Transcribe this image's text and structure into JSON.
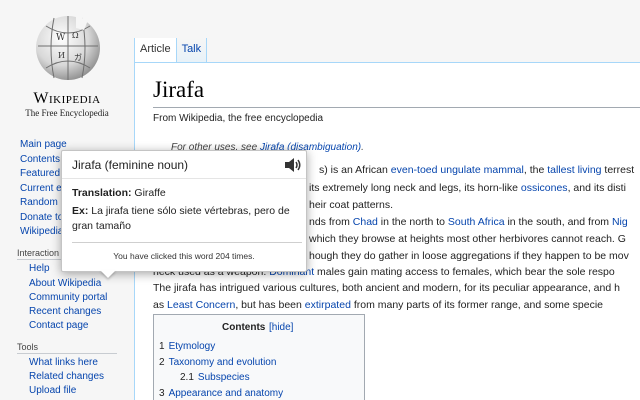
{
  "logo": {
    "wordmark": "Wikipedia",
    "tagline": "The Free Encyclopedia"
  },
  "sidebar": {
    "main_links": [
      "Main page",
      "Contents",
      "Featured c",
      "Current ev",
      "Random a",
      "Donate to",
      "Wikipedia"
    ],
    "interaction_heading": "Interaction",
    "interaction_links": [
      "Help",
      "About Wikipedia",
      "Community portal",
      "Recent changes",
      "Contact page"
    ],
    "tools_heading": "Tools",
    "tools_links": [
      "What links here",
      "Related changes",
      "Upload file"
    ]
  },
  "tabs": {
    "article": "Article",
    "talk": "Talk"
  },
  "article": {
    "title": "Jirafa",
    "subtitle": "From Wikipedia, the free encyclopedia",
    "hatnote_prefix": "For other uses, see ",
    "hatnote_link": "Jirafa (disambiguation)",
    "hatnote_suffix": ".",
    "line1": {
      "a": "s) is an African ",
      "b": "even-toed ungulate mammal",
      "c": ", the ",
      "d": "tallest living",
      "e": " terrest"
    },
    "line2": {
      "a": "its extremely long neck and legs, its horn-like ",
      "b": "ossicones",
      "c": ", and its disti"
    },
    "line3": {
      "a": "heir coat patterns."
    },
    "line4": {
      "a": "nds from ",
      "b": "Chad",
      "c": " in the north to ",
      "d": "South Africa",
      "e": " in the south, and from ",
      "f": "Nig"
    },
    "line5": {
      "a": " which they browse at heights most other herbivores cannot reach. G"
    },
    "line6": {
      "a": "hough they do gather in loose aggregations if they happen to be mov"
    },
    "line7": {
      "a": "neck ",
      "b": "used as a weapon. ",
      "c": "Dominant",
      "d": " males gain mating access to females, which bear the sole respo"
    },
    "line8": {
      "a": "The jirafa has intrigued various cultures, both ancient and modern, for its peculiar appearance, and h"
    },
    "line9": {
      "a": "as ",
      "b": "Least Concern",
      "c": ", but has been ",
      "d": "extirpated",
      "e": " from many parts of its former range, and some specie"
    }
  },
  "toc": {
    "title": "Contents",
    "hide": "[hide]",
    "items": [
      {
        "num": "1",
        "label": "Etymology"
      },
      {
        "num": "2",
        "label": "Taxonomy and evolution"
      },
      {
        "num": "2.1",
        "label": "Subspecies"
      },
      {
        "num": "3",
        "label": "Appearance and anatomy"
      }
    ]
  },
  "popup": {
    "word": "Jirafa (feminine noun)",
    "translation_label": "Translation:",
    "translation_value": " Giraffe",
    "example_label": "Ex:",
    "example_value": " La jirafa tiene sólo siete vértebras, pero de gran tamaño",
    "click_count": "You have clicked this word 204 times.",
    "speaker_icon": "speaker-icon"
  },
  "colors": {
    "link": "#0645ad",
    "redlink": "#ba0000",
    "tab_border": "#a7d7f9"
  }
}
